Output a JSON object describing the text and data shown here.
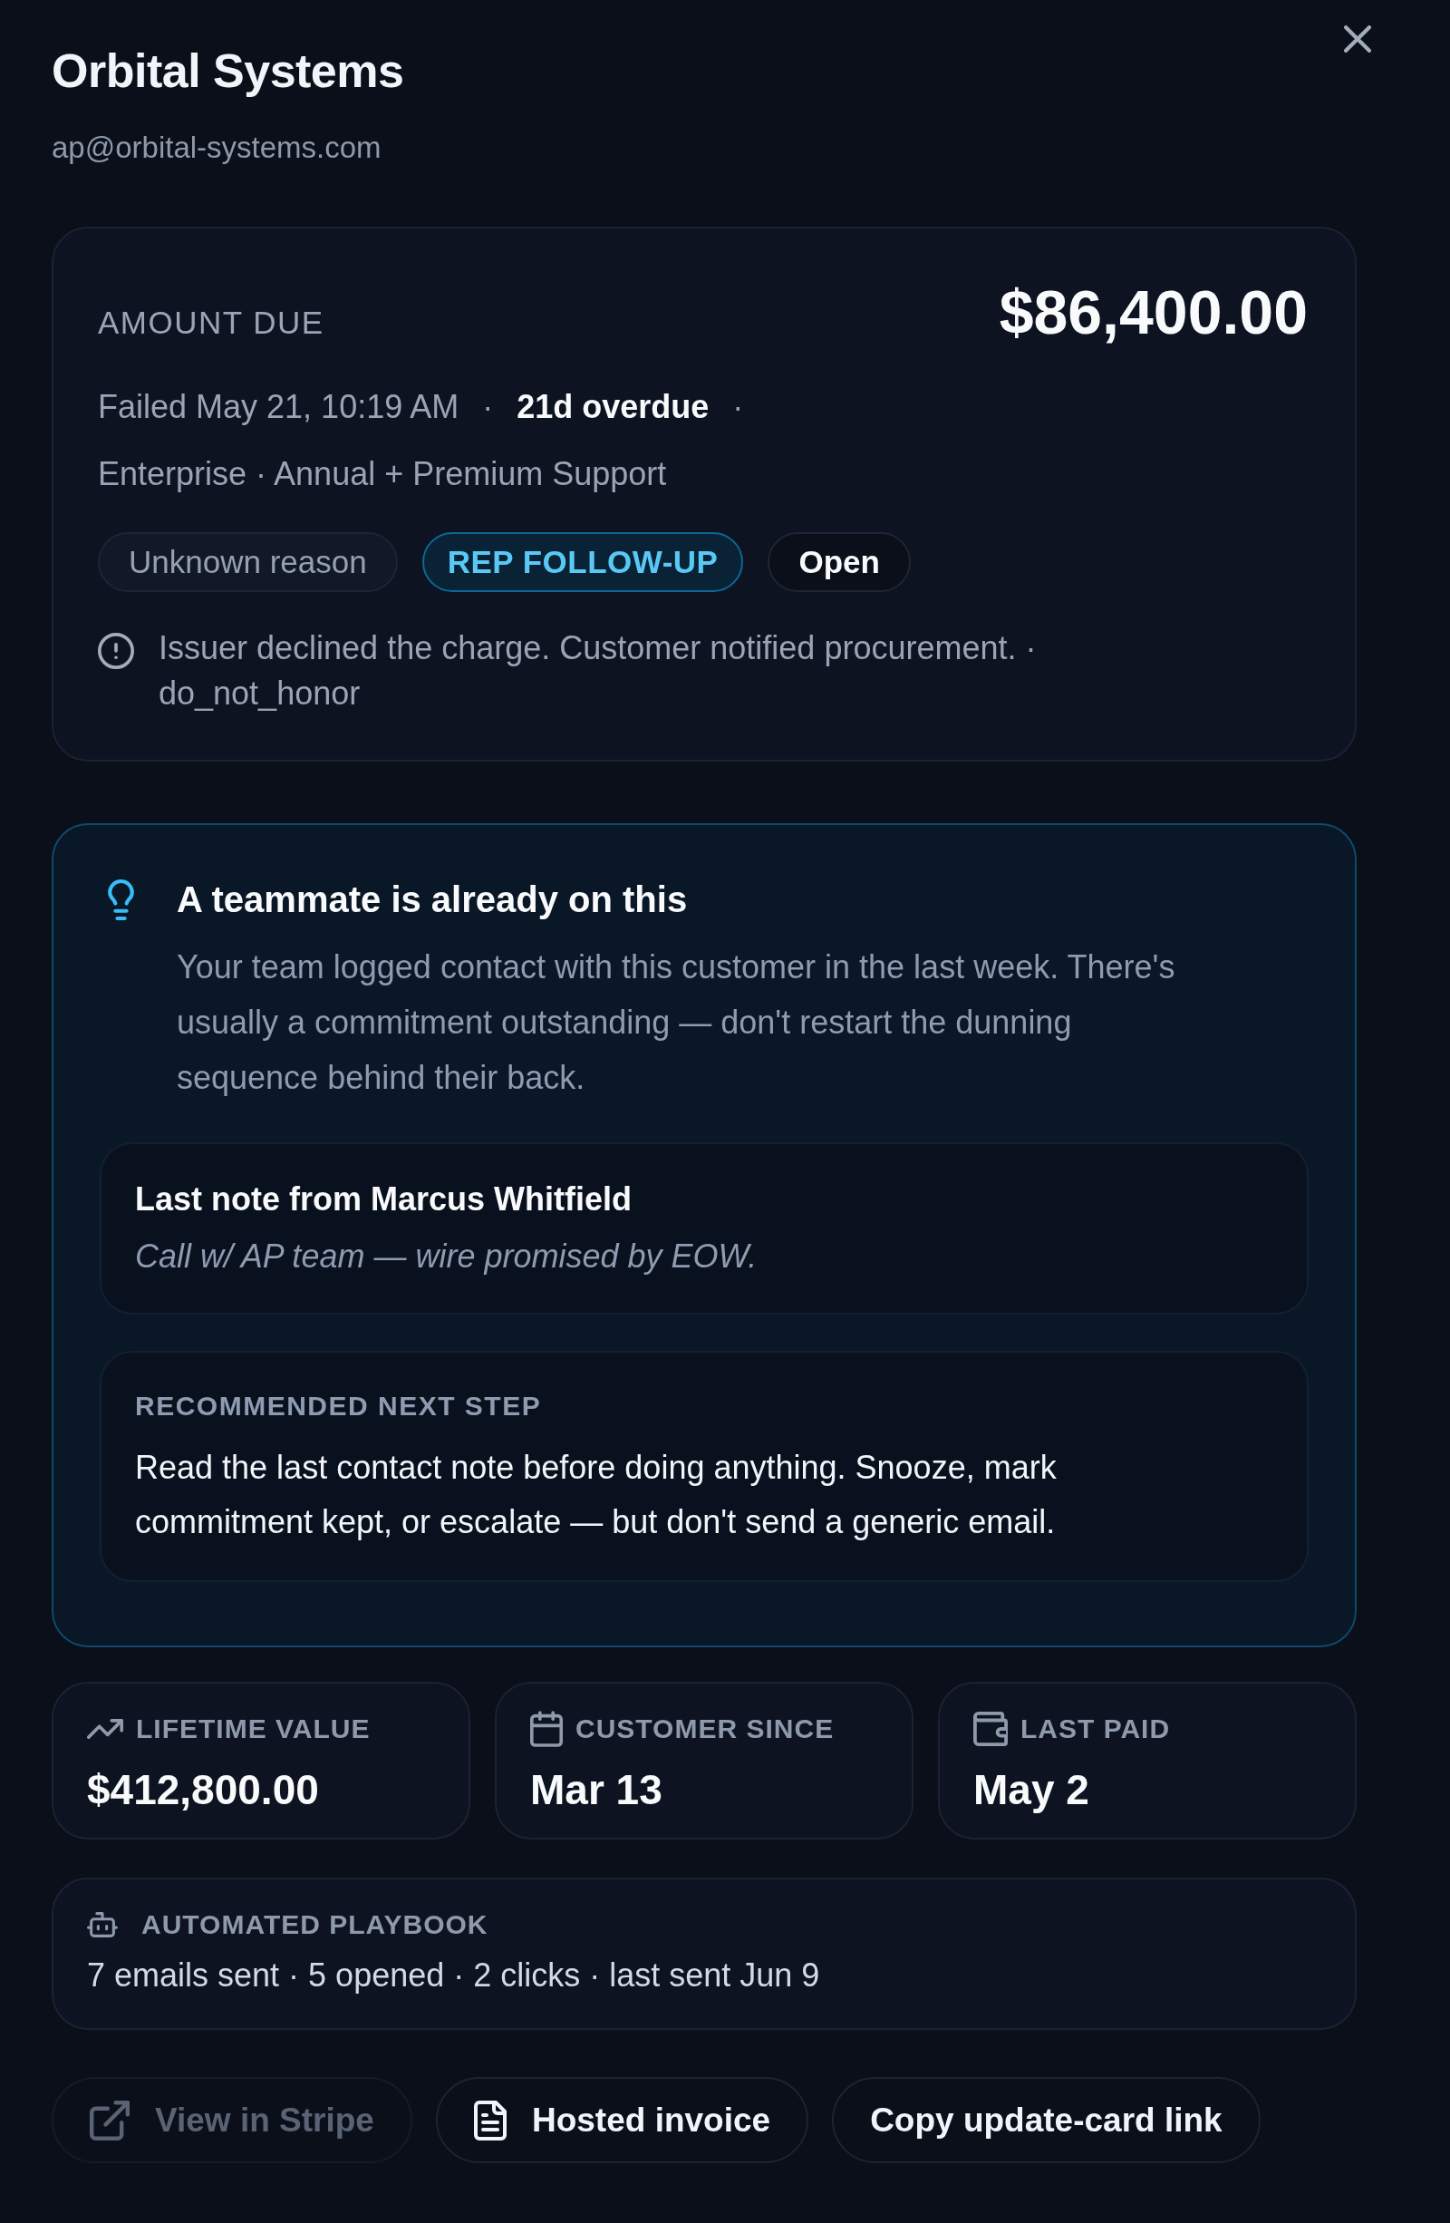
{
  "header": {
    "title": "Orbital Systems",
    "email": "ap@orbital-systems.com"
  },
  "amount_card": {
    "label": "AMOUNT DUE",
    "amount": "$86,400.00",
    "meta": [
      {
        "text": "Failed May 21, 10:19 AM",
        "kind": "plain"
      },
      {
        "text": "·",
        "kind": "separator"
      },
      {
        "text": "21d overdue",
        "kind": "strong"
      },
      {
        "text": "·",
        "kind": "separator"
      }
    ],
    "plan": "Enterprise · Annual + Premium Support",
    "tags": [
      {
        "label": "Unknown reason",
        "kind": "reason"
      },
      {
        "label": "REP FOLLOW-UP",
        "kind": "follow_up"
      },
      {
        "label": "Open",
        "kind": "status"
      }
    ],
    "decline_message": "Issuer declined the charge. Customer notified procurement. · do_not_honor"
  },
  "teammate_notice": {
    "title": "A teammate is already on this",
    "body": "Your team logged contact with this customer in the last week. There's usually a commitment outstanding — don't restart the dunning sequence behind their back.",
    "last_note": {
      "heading": "Last note from Marcus Whitfield",
      "text": "Call w/ AP team — wire promised by EOW."
    },
    "next_step": {
      "label": "RECOMMENDED NEXT STEP",
      "text": "Read the last contact note before doing anything. Snooze, mark commitment kept, or escalate — but don't send a generic email."
    }
  },
  "stats": [
    {
      "kind": "lifetime",
      "label": "LIFETIME VALUE",
      "value": "$412,800.00"
    },
    {
      "kind": "since",
      "label": "CUSTOMER SINCE",
      "value": "Mar 13"
    },
    {
      "kind": "last_paid",
      "label": "LAST PAID",
      "value": "May 2"
    }
  ],
  "playbook": {
    "label": "AUTOMATED PLAYBOOK",
    "summary": "7 emails sent · 5 opened · 2 clicks · last sent Jun 9"
  },
  "actions": [
    {
      "label": "View in Stripe",
      "kind": "external",
      "disabled": true
    },
    {
      "label": "Hosted invoice",
      "kind": "document",
      "disabled": false
    },
    {
      "label": "Copy update-card link",
      "kind": "plain",
      "disabled": false
    }
  ]
}
